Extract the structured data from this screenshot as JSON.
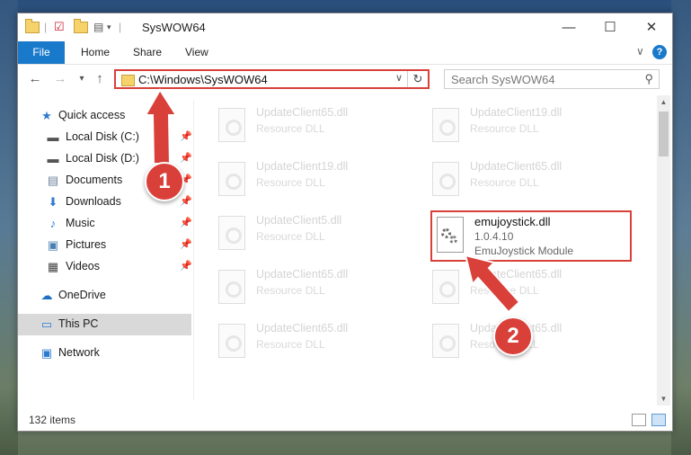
{
  "window": {
    "title": "SysWOW64"
  },
  "ribbon": {
    "tabs": [
      "File",
      "Home",
      "Share",
      "View"
    ]
  },
  "nav": {
    "address": "C:\\Windows\\SysWOW64",
    "search_placeholder": "Search SysWOW64"
  },
  "sidebar": {
    "items": [
      {
        "label": "Quick access",
        "icon": "star-icon"
      },
      {
        "label": "Local Disk (C:)",
        "icon": "drive-icon"
      },
      {
        "label": "Local Disk (D:)",
        "icon": "drive-icon"
      },
      {
        "label": "Documents",
        "icon": "documents-icon"
      },
      {
        "label": "Downloads",
        "icon": "download-icon"
      },
      {
        "label": "Music",
        "icon": "music-icon"
      },
      {
        "label": "Pictures",
        "icon": "pictures-icon"
      },
      {
        "label": "Videos",
        "icon": "videos-icon"
      },
      {
        "label": "OneDrive",
        "icon": "cloud-icon"
      },
      {
        "label": "This PC",
        "icon": "computer-icon"
      },
      {
        "label": "Network",
        "icon": "network-icon"
      }
    ]
  },
  "files": [
    {
      "name": "UpdateClient65.dll",
      "desc": "Resource DLL"
    },
    {
      "name": "UpdateClient19.dll",
      "desc": "Resource DLL"
    },
    {
      "name": "UpdateClient19.dll",
      "desc": "Resource DLL"
    },
    {
      "name": "UpdateClient65.dll",
      "desc": "Resource DLL"
    },
    {
      "name": "UpdateClient5.dll",
      "desc": "Resource DLL"
    },
    {
      "name": "UpdateClient65.dll",
      "desc": "Resource DLL"
    },
    {
      "name": "UpdateClient65.dll",
      "desc": "Resource DLL"
    },
    {
      "name": "UpdateClient65.dll",
      "desc": "Resource DLL"
    },
    {
      "name": "UpdateClient65.dll",
      "desc": "Resource DLL"
    }
  ],
  "target_file": {
    "name": "emujoystick.dll",
    "version": "1.0.4.10",
    "desc": "EmuJoystick Module"
  },
  "status": {
    "count": "132 items"
  },
  "annotations": {
    "badge1": "1",
    "badge2": "2",
    "color": "#d9403a"
  }
}
